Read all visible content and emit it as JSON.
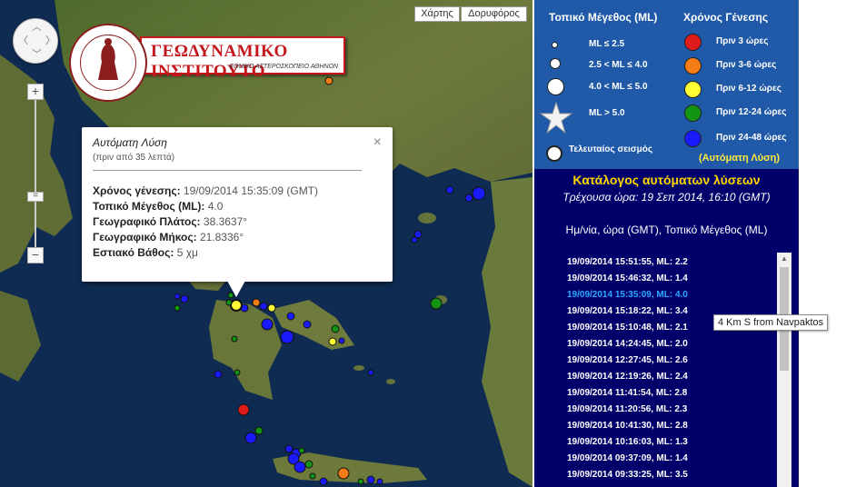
{
  "map": {
    "type_buttons": {
      "map_label": "Χάρτης",
      "satellite_label": "Δορυφόρος"
    },
    "zoom": {
      "in_label": "+",
      "out_label": "−"
    },
    "logo": {
      "title": "ΓΕΩΔΥΝΑΜΙΚΟ ΙΝΣΤΙΤΟΥΤΟ",
      "subtitle": "ΕΘΝΙΚΟ ΑΣΤΕΡΟΣΚΟΠΕΙΟ ΑΘΗΝΩΝ"
    },
    "info_window": {
      "title": "Αυτόματη Λύση",
      "subtitle": "(πριν από 35 λεπτά)",
      "close_label": "×",
      "rows": [
        {
          "label": "Χρόνος γένεσης:",
          "value": "19/09/2014  15:35:09 (GMT)"
        },
        {
          "label": "Τοπικό Μέγεθος (ML):",
          "value": "4.0"
        },
        {
          "label": "Γεωγραφικό Πλάτος:",
          "value": "38.3637°"
        },
        {
          "label": "Γεωγραφικό Μήκος:",
          "value": "21.8336°"
        },
        {
          "label": "Εστιακό Βάθος:",
          "value": "5 χμ"
        }
      ]
    }
  },
  "legend": {
    "magnitude_header": "Τοπικό Μέγεθος (ML)",
    "age_header": "Χρόνος Γένεσης",
    "magnitudes": [
      "ML ≤ 2.5",
      "2.5 < ML ≤ 4.0",
      "4.0 < ML ≤ 5.0",
      "ML > 5.0",
      "Τελευταίος σεισμός"
    ],
    "ages": [
      {
        "label": "Πριν 3 ώρες",
        "color": "#e01b1b"
      },
      {
        "label": "Πριν 3-6 ώρες",
        "color": "#f57c17"
      },
      {
        "label": "Πριν 6-12 ώρες",
        "color": "#ffff33"
      },
      {
        "label": "Πριν 12-24 ώρες",
        "color": "#139413"
      },
      {
        "label": "Πριν 24-48 ώρες",
        "color": "#1a1aff"
      }
    ],
    "auto_label": "(Αυτόματη Λύση)"
  },
  "catalog": {
    "title": "Κατάλογος αυτόματων λύσεων",
    "current_time": "Τρέχουσα ώρα: 19 Σεπ 2014, 16:10 (GMT)",
    "header": "Ημ/νία, ώρα (GMT), Τοπικό Μέγεθος (ML)",
    "items": [
      "19/09/2014  15:51:55,   ML: 2.2",
      "19/09/2014  15:46:32,   ML: 1.4",
      "19/09/2014  15:35:09,   ML: 4.0",
      "19/09/2014  15:18:22,   ML: 3.4",
      "19/09/2014  15:10:48,   ML: 2.1",
      "19/09/2014  14:24:45,   ML: 2.0",
      "19/09/2014  12:27:45,   ML: 2.6",
      "19/09/2014  12:19:26,   ML: 2.4",
      "19/09/2014  11:41:54,   ML: 2.8",
      "19/09/2014  11:20:56,   ML: 2.3",
      "19/09/2014  10:41:30,   ML: 2.8",
      "19/09/2014  10:16:03,   ML: 1.3",
      "19/09/2014  09:37:09,   ML: 1.4",
      "19/09/2014  09:33:25,   ML: 3.5"
    ],
    "selected_index": 2,
    "tooltip": "4 Km S from Navpaktos",
    "scroll_up_label": "▲"
  }
}
